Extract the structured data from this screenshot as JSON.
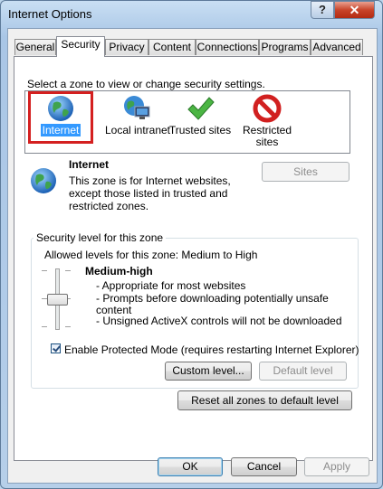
{
  "window": {
    "title": "Internet Options",
    "help_label": "?",
    "close_label": "✕"
  },
  "tabs": [
    {
      "label": "General"
    },
    {
      "label": "Security"
    },
    {
      "label": "Privacy"
    },
    {
      "label": "Content"
    },
    {
      "label": "Connections"
    },
    {
      "label": "Programs"
    },
    {
      "label": "Advanced"
    }
  ],
  "security": {
    "zone_prompt": "Select a zone to view or change security settings.",
    "zones": [
      {
        "label": "Internet",
        "icon": "globe-icon"
      },
      {
        "label": "Local intranet",
        "icon": "intranet-icon"
      },
      {
        "label": "Trusted sites",
        "icon": "checkmark-icon"
      },
      {
        "label": "Restricted sites",
        "label_line1": "Restricted",
        "label_line2": "sites",
        "icon": "restricted-icon"
      }
    ],
    "selected_zone": {
      "name": "Internet",
      "desc_line1": "This zone is for Internet websites,",
      "desc_line2": "except those listed in trusted and",
      "desc_line3": "restricted zones."
    },
    "sites_button": "Sites",
    "level_group_title": "Security level for this zone",
    "allowed_levels": "Allowed levels for this zone: Medium to High",
    "level_name": "Medium-high",
    "level_bullets": [
      "- Appropriate for most websites",
      "- Prompts before downloading potentially unsafe",
      "content",
      "- Unsigned ActiveX controls will not be downloaded"
    ],
    "protected_mode_label": "Enable Protected Mode (requires restarting Internet Explorer)",
    "protected_mode_checked": true,
    "custom_level_button": "Custom level...",
    "default_level_button": "Default level",
    "reset_all_button": "Reset all zones to default level"
  },
  "footer": {
    "ok": "OK",
    "cancel": "Cancel",
    "apply": "Apply"
  },
  "colors": {
    "selection_highlight": "#d42020",
    "accent": "#3399ff"
  }
}
